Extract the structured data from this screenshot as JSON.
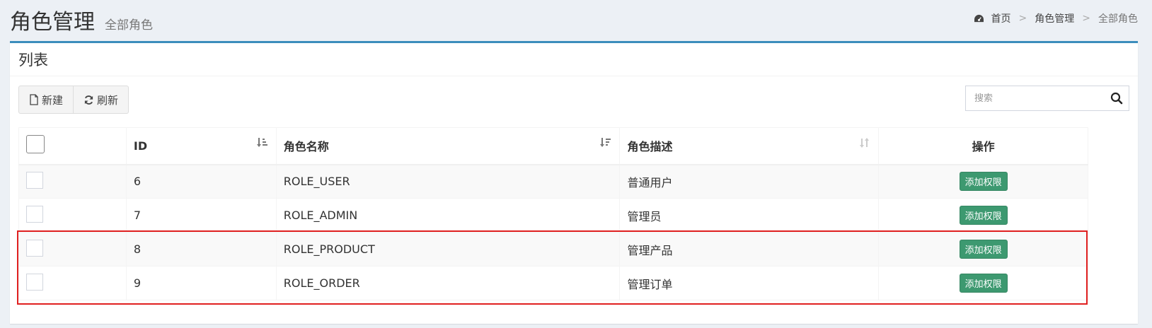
{
  "header": {
    "title": "角色管理",
    "subtitle": "全部角色"
  },
  "breadcrumb": {
    "icon": "dashboard-icon",
    "items": [
      "首页",
      "角色管理",
      "全部角色"
    ],
    "separator": ">"
  },
  "box": {
    "title": "列表"
  },
  "toolbar": {
    "new_label": "新建",
    "refresh_label": "刷新"
  },
  "search": {
    "placeholder": "搜索",
    "value": ""
  },
  "table": {
    "columns": [
      "",
      "ID",
      "角色名称",
      "角色描述",
      "操作"
    ],
    "rows": [
      {
        "id": "6",
        "name": "ROLE_USER",
        "desc": "普通用户",
        "action": "添加权限"
      },
      {
        "id": "7",
        "name": "ROLE_ADMIN",
        "desc": "管理员",
        "action": "添加权限"
      },
      {
        "id": "8",
        "name": "ROLE_PRODUCT",
        "desc": "管理产品",
        "action": "添加权限"
      },
      {
        "id": "9",
        "name": "ROLE_ORDER",
        "desc": "管理订单",
        "action": "添加权限"
      }
    ]
  },
  "colors": {
    "accent": "#3c8dbc",
    "action_button": "#3d9970",
    "highlight": "#e02020"
  }
}
